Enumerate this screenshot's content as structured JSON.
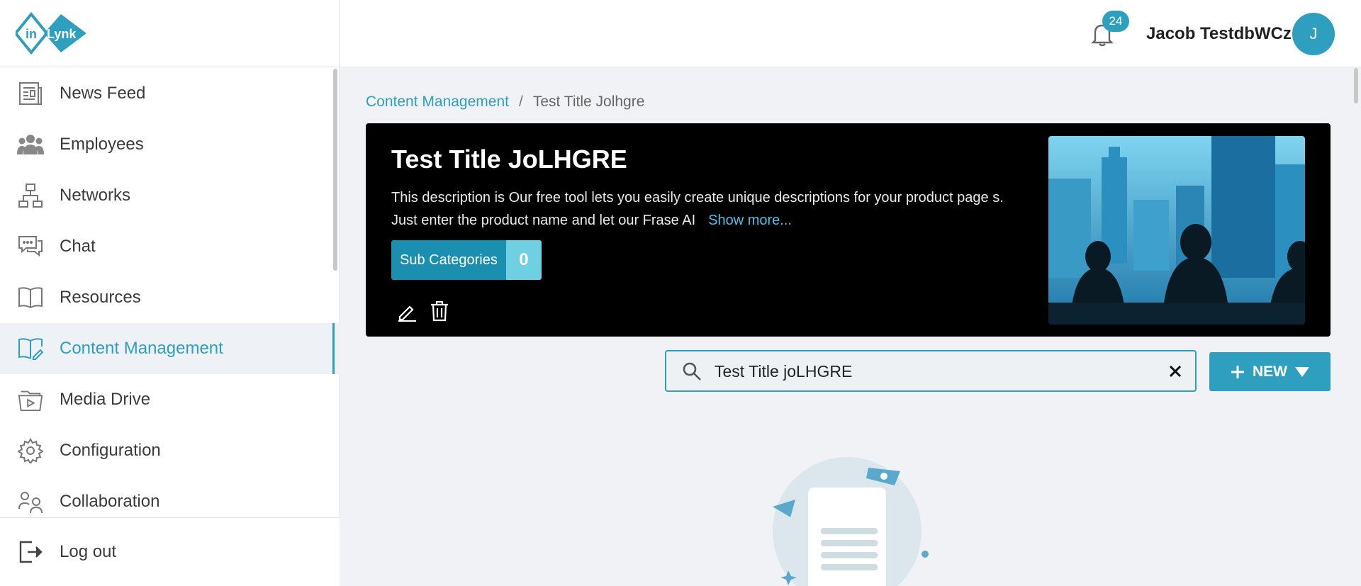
{
  "app": {
    "logo_text_left": "in",
    "logo_text_right": "Lynk"
  },
  "sidebar": {
    "items": [
      {
        "label": "News Feed",
        "icon": "newspaper-icon"
      },
      {
        "label": "Employees",
        "icon": "users-icon"
      },
      {
        "label": "Networks",
        "icon": "network-icon"
      },
      {
        "label": "Chat",
        "icon": "chat-icon"
      },
      {
        "label": "Resources",
        "icon": "book-icon"
      },
      {
        "label": "Content Management",
        "icon": "book-edit-icon",
        "active": true
      },
      {
        "label": "Media Drive",
        "icon": "media-folder-icon"
      },
      {
        "label": "Configuration",
        "icon": "gear-icon"
      },
      {
        "label": "Collaboration",
        "icon": "collaboration-icon"
      }
    ],
    "logout": "Log out"
  },
  "header": {
    "notifications": "24",
    "user_name": "Jacob TestdbWCz",
    "avatar_initial": "J"
  },
  "breadcrumb": {
    "parent": "Content Management",
    "separator": "/",
    "current": "Test Title Jolhgre"
  },
  "banner": {
    "title": "Test Title JoLHGRE",
    "description": "This description is Our free tool lets you easily create unique descriptions for your product page s. Just enter the product name and let our Frase AI",
    "show_more": "Show more...",
    "subcategories_label": "Sub Categories",
    "subcategories_count": "0"
  },
  "search": {
    "value": "Test Title joLHGRE"
  },
  "new_button": {
    "label": "NEW"
  },
  "colors": {
    "accent": "#2e9fbf",
    "banner_bg": "#000000",
    "page_bg": "#f0f2f5"
  }
}
